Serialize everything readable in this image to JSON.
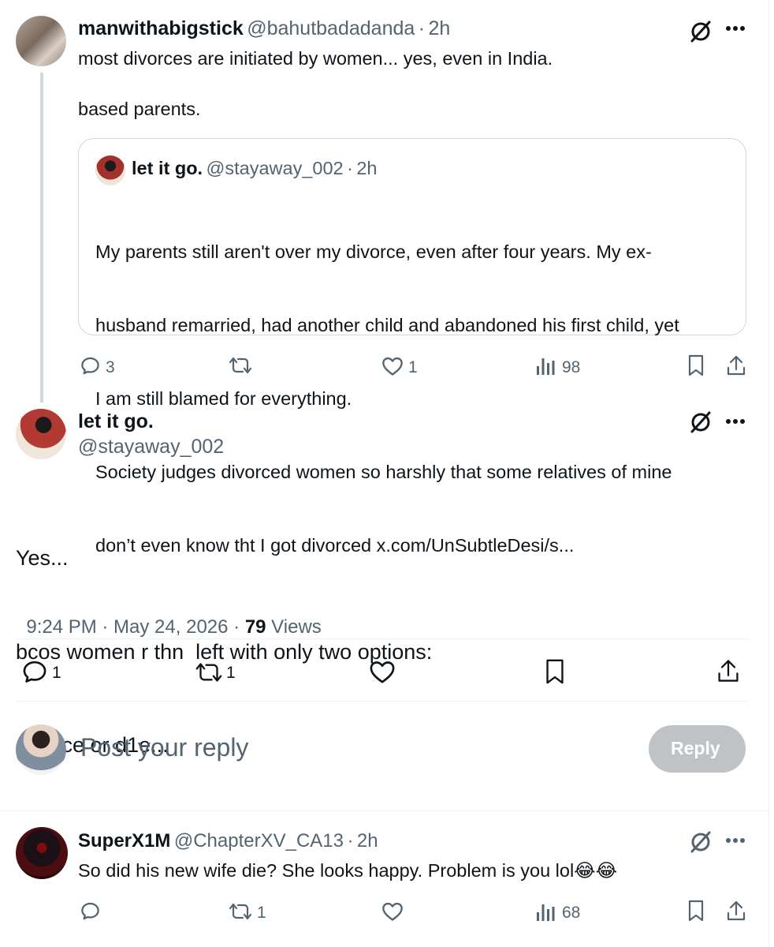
{
  "post1": {
    "display_name": "manwithabigstick",
    "handle": "@bahutbadadanda",
    "sep": "·",
    "time": "2h",
    "text_line1": "most divorces are initiated by women... yes, even in India.",
    "text_line2": "based parents.",
    "quote": {
      "display_name": "let it go.",
      "handle": "@stayaway_002",
      "sep": "·",
      "time": "2h",
      "lines": [
        "My parents still aren't over my divorce, even after four years. My ex-",
        "husband remarried, had another child and abandoned his first child, yet",
        "I am still blamed for everything.",
        "Society judges divorced women so harshly that some relatives of mine",
        "don’t even know tht I got divorced x.com/UnSubtleDesi/s..."
      ]
    },
    "actions": {
      "replies": "3",
      "reposts": "",
      "likes": "1",
      "views": "98"
    }
  },
  "main_post": {
    "display_name": "let it go.",
    "handle": "@stayaway_002",
    "lines": [
      "Yes...",
      "bcos women r thn  left with only two options:",
      "divorce or d1e..."
    ],
    "timestamp": "9:24 PM · May 24, 2026 · ",
    "views_count": "79",
    "views_label": " Views",
    "actions": {
      "replies": "1",
      "reposts": "1",
      "likes": "",
      "bookmarks": ""
    }
  },
  "composer": {
    "placeholder": "Post your reply",
    "reply_button": "Reply"
  },
  "reply1": {
    "display_name": "SuperX1M",
    "handle": "@ChapterXV_CA13",
    "sep": "·",
    "time": "2h",
    "text": "So did his new wife die? She looks happy. Problem is you lol😂😂",
    "actions": {
      "replies": "",
      "reposts": "1",
      "likes": "",
      "views": "68"
    }
  },
  "icons": {
    "grok": "grok-icon",
    "more": "more-icon",
    "reply": "reply-icon",
    "repost": "repost-icon",
    "like": "like-icon",
    "views": "views-icon",
    "bookmark": "bookmark-icon",
    "share": "share-icon"
  },
  "colors": {
    "text_primary": "#0f1419",
    "text_secondary": "#536471",
    "border": "#cfd9de",
    "reply_button_disabled": "#8b9196"
  }
}
